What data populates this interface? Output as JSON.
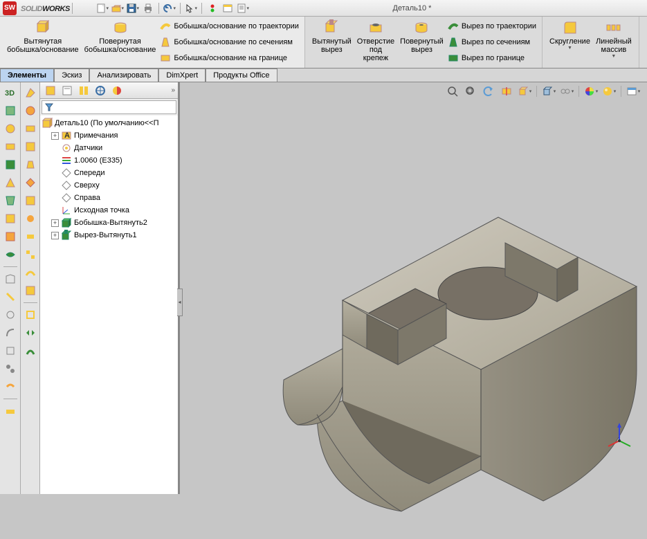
{
  "app": {
    "brand_prefix": "SOLID",
    "brand_suffix": "WORKS",
    "title": "Деталь10 *"
  },
  "ribbon": {
    "g1": {
      "extruded_boss": "Вытянутая\nбобышка/основание",
      "revolved_boss": "Повернутая\nбобышка/основание",
      "swept_boss": "Бобышка/основание по траектории",
      "lofted_boss": "Бобышка/основание по сечениям",
      "boundary_boss": "Бобышка/основание на границе"
    },
    "g2": {
      "extruded_cut": "Вытянутый\nвырез",
      "hole": "Отверстие\nпод\nкрепеж",
      "revolved_cut": "Повернутый\nвырез",
      "swept_cut": "Вырез по траектории",
      "lofted_cut": "Вырез по сечениям",
      "boundary_cut": "Вырез по границе"
    },
    "g3": {
      "fillet": "Скругление",
      "linear_pattern": "Линейный\nмассив"
    }
  },
  "tabs": {
    "t1": "Элементы",
    "t2": "Эскиз",
    "t3": "Анализировать",
    "t4": "DimXpert",
    "t5": "Продукты Office"
  },
  "tree": {
    "root": "Деталь10  (По умолчанию<<П",
    "annotations": "Примечания",
    "sensors": "Датчики",
    "material": "1.0060 (E335)",
    "front": "Спереди",
    "top": "Сверху",
    "right": "Справа",
    "origin": "Исходная точка",
    "boss": "Бобышка-Вытянуть2",
    "cut": "Вырез-Вытянуть1"
  },
  "icons": {
    "new": "new",
    "open": "open",
    "save": "save",
    "print": "print",
    "undo": "undo",
    "select": "select",
    "rebuild": "rebuild",
    "options": "options",
    "doc": "doc"
  }
}
